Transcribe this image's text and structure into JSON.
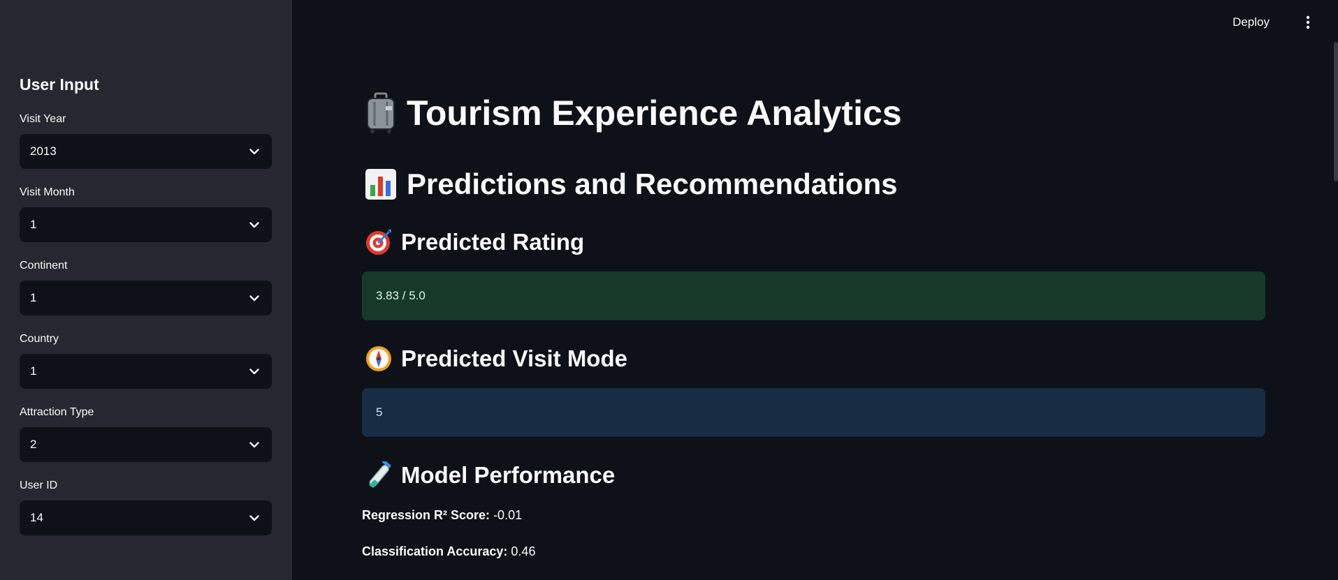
{
  "sidebar": {
    "title": "User Input",
    "fields": [
      {
        "label": "Visit Year",
        "value": "2013"
      },
      {
        "label": "Visit Month",
        "value": "1"
      },
      {
        "label": "Continent",
        "value": "1"
      },
      {
        "label": "Country",
        "value": "1"
      },
      {
        "label": "Attraction Type",
        "value": "2"
      },
      {
        "label": "User ID",
        "value": "14"
      }
    ]
  },
  "header": {
    "deploy_label": "Deploy"
  },
  "main": {
    "title": "Tourism Experience Analytics",
    "section_title": "Predictions and Recommendations",
    "rating": {
      "heading": "Predicted Rating",
      "value": "3.83 / 5.0"
    },
    "visit_mode": {
      "heading": "Predicted Visit Mode",
      "value": "5"
    },
    "performance": {
      "heading": "Model Performance",
      "r2_label": "Regression R² Score:",
      "r2_value": " -0.01",
      "acc_label": "Classification Accuracy:",
      "acc_value": " 0.46"
    }
  },
  "colors": {
    "sidebar_bg": "#262730",
    "main_bg": "#0e1117",
    "success_bg": "#173928",
    "info_bg": "#172d43"
  },
  "icons": [
    "luggage-icon",
    "bar-chart-icon",
    "target-icon",
    "compass-icon",
    "test-tube-icon",
    "chevron-down-icon",
    "kebab-menu-icon"
  ]
}
